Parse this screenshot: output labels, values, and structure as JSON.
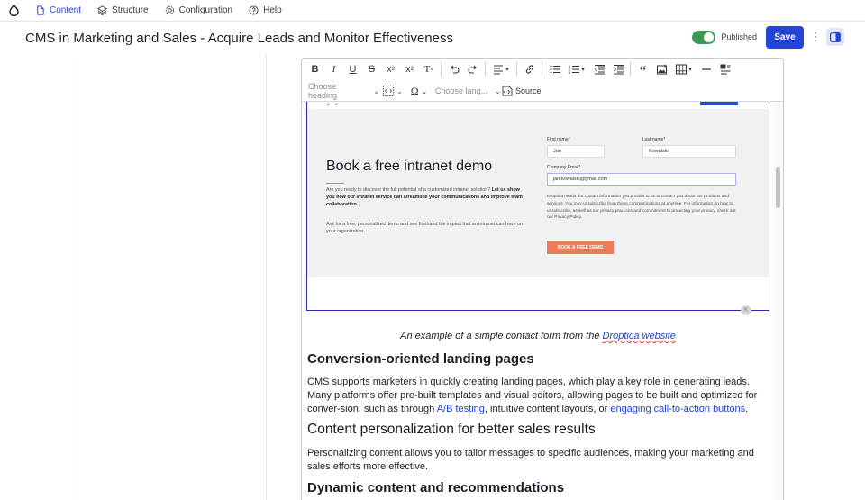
{
  "nav": {
    "tabs": [
      {
        "label": "Content",
        "icon": "document-icon",
        "active": true
      },
      {
        "label": "Structure",
        "icon": "layers-icon",
        "active": false
      },
      {
        "label": "Configuration",
        "icon": "gear-icon",
        "active": false
      },
      {
        "label": "Help",
        "icon": "help-circle-icon",
        "active": false
      }
    ]
  },
  "header": {
    "title": "CMS in Marketing and Sales - Acquire Leads and Monitor Effectiveness",
    "published_label": "Published",
    "published": true,
    "save_label": "Save",
    "accent_color": "#2344d7",
    "toggle_color": "#3b9a55"
  },
  "toolbar": {
    "heading_placeholder": "Choose heading",
    "language_placeholder": "Choose lang...",
    "source_label": "Source"
  },
  "figure": {
    "heading": "Book a free intranet demo",
    "intro": "Are you ready to discover the full potential of a customized intranet solution?",
    "intro_bold": "Let us show you how our intranet service can streamline your communications and improve team collaboration.",
    "paragraph": "Ask for a free, personalized demo and see firsthand the impact that an intranet can have on your organization.",
    "first_name_label": "First name*",
    "first_name_value": "Jan",
    "last_name_label": "Last name*",
    "last_name_value": "Kowalski",
    "email_label": "Company Email*",
    "email_value": "jan.kowalski@gmail.com",
    "note": "Droptica needs the contact information you provide to us to contact you about our products and services. You may unsubscribe from these communications at anytime. For information on how to unsubscribe, as well as our privacy practices and commitment to protecting your privacy, check out our Privacy Policy.",
    "button_label": "BOOK A FREE DEMO",
    "button_color": "#ee7b5b"
  },
  "article": {
    "caption_prefix": "An example of a simple contact form from the ",
    "caption_link": "Droptica website",
    "h_conversion": "Conversion-oriented landing pages",
    "p_conversion_1": "CMS supports marketers in quickly creating landing pages, which play a key role in generating leads. Many platforms offer pre-built templates and visual editors, allowing pages to be built and optimized for conver-sion, such as through ",
    "p_conversion_link1": "A/B testing",
    "p_conversion_2": ", intuitive content layouts, or ",
    "p_conversion_link2": "engaging call-to-action buttons",
    "p_conversion_3": ".",
    "h_personalization": "Content personalization for better sales results",
    "p_personalization": "Personalizing content allows you to tailor messages to specific audiences, making your marketing and sales efforts more effective.",
    "h_dynamic": "Dynamic content and recommendations"
  }
}
